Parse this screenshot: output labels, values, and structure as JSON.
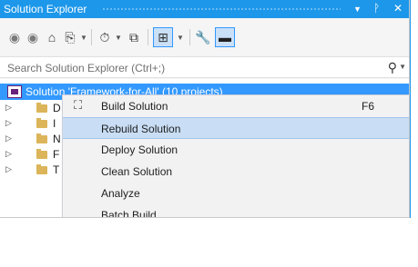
{
  "window": {
    "title": "Solution Explorer",
    "pin_icon": "pin-icon",
    "close_icon": "close-icon",
    "dropdown_icon": "window-position-dropdown-icon"
  },
  "toolbar": {
    "icons": [
      "back-icon",
      "forward-icon",
      "home-icon",
      "switch-views-icon",
      "pending-changes-filter-icon",
      "collapse-all-icon",
      "show-all-files-icon",
      "preview-selected-items-icon",
      "properties-icon",
      "dash-icon"
    ]
  },
  "search": {
    "placeholder": "Search Solution Explorer (Ctrl+;)"
  },
  "tree": {
    "root_label": "Solution 'Framework-for-All' (10 projects)",
    "items": [
      {
        "letter": "D"
      },
      {
        "letter": "I"
      },
      {
        "letter": "N"
      },
      {
        "letter": "F"
      },
      {
        "letter": "T"
      }
    ]
  },
  "context_menu": {
    "items": [
      {
        "label": "Build Solution",
        "shortcut": "F6",
        "icon": "build-icon"
      },
      {
        "label": "Rebuild Solution",
        "shortcut": "",
        "icon": ""
      },
      {
        "label": "Deploy Solution",
        "shortcut": "",
        "icon": ""
      },
      {
        "label": "Clean Solution",
        "shortcut": "",
        "icon": ""
      },
      {
        "label": "Analyze",
        "shortcut": "",
        "icon": ""
      },
      {
        "label": "Batch Build...",
        "shortcut": "",
        "icon": ""
      }
    ],
    "highlighted_index": 1
  },
  "colors": {
    "accent": "#1c97ea",
    "selection": "#3399ff",
    "menu_highlight": "#c9def5"
  }
}
